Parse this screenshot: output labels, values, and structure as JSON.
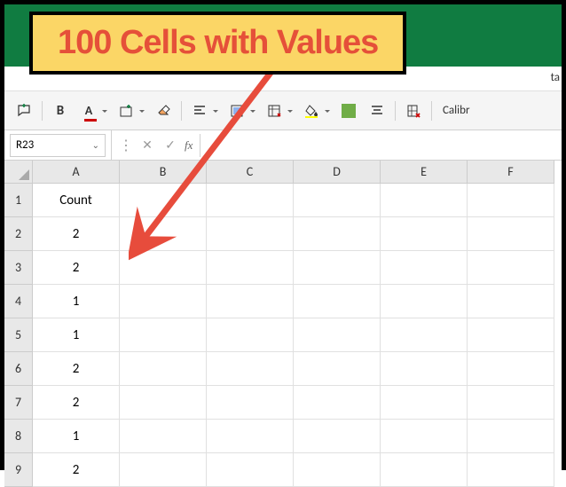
{
  "callout": {
    "text": "100 Cells with Values"
  },
  "ribbon": {
    "visible_fragment": "ta"
  },
  "toolbar": {
    "font_name": "Calibr"
  },
  "namebox": {
    "cell_ref": "R23"
  },
  "formula_bar": {
    "value": "",
    "fx_label": "fx"
  },
  "grid": {
    "columns": [
      "A",
      "B",
      "C",
      "D",
      "E",
      "F"
    ],
    "rows": [
      {
        "num": "1",
        "cells": [
          "Count",
          "",
          "",
          "",
          "",
          ""
        ]
      },
      {
        "num": "2",
        "cells": [
          "2",
          "",
          "",
          "",
          "",
          ""
        ]
      },
      {
        "num": "3",
        "cells": [
          "2",
          "",
          "",
          "",
          "",
          ""
        ]
      },
      {
        "num": "4",
        "cells": [
          "1",
          "",
          "",
          "",
          "",
          ""
        ]
      },
      {
        "num": "5",
        "cells": [
          "1",
          "",
          "",
          "",
          "",
          ""
        ]
      },
      {
        "num": "6",
        "cells": [
          "2",
          "",
          "",
          "",
          "",
          ""
        ]
      },
      {
        "num": "7",
        "cells": [
          "2",
          "",
          "",
          "",
          "",
          ""
        ]
      },
      {
        "num": "8",
        "cells": [
          "1",
          "",
          "",
          "",
          "",
          ""
        ]
      },
      {
        "num": "9",
        "cells": [
          "2",
          "",
          "",
          "",
          "",
          ""
        ]
      }
    ]
  }
}
